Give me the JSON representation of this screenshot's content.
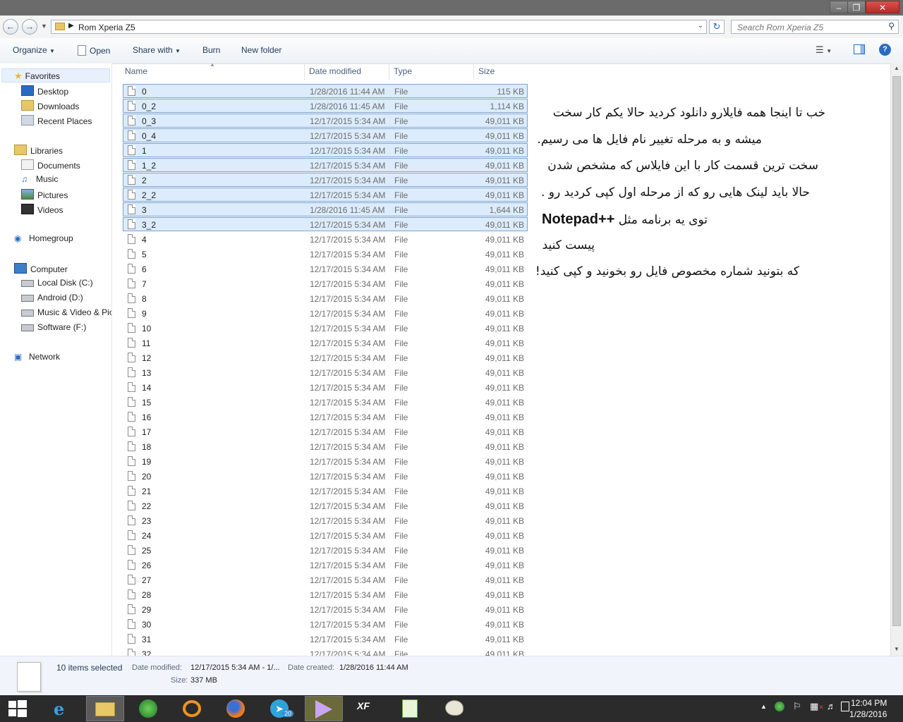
{
  "address": {
    "path": "Rom Xperia Z5",
    "search_placeholder": "Search Rom Xperia Z5"
  },
  "toolbar": {
    "organize": "Organize",
    "open": "Open",
    "share_with": "Share with",
    "burn": "Burn",
    "new_folder": "New folder"
  },
  "nav": {
    "favorites": "Favorites",
    "desktop": "Desktop",
    "downloads": "Downloads",
    "recent": "Recent Places",
    "libraries": "Libraries",
    "documents": "Documents",
    "music": "Music",
    "pictures": "Pictures",
    "videos": "Videos",
    "homegroup": "Homegroup",
    "computer": "Computer",
    "local_disk": "Local Disk (C:)",
    "android": "Android (D:)",
    "music_video": "Music & Video & Pic",
    "software": "Software (F:)",
    "network": "Network"
  },
  "columns": {
    "name": "Name",
    "date": "Date modified",
    "type": "Type",
    "size": "Size"
  },
  "files": [
    {
      "name": "0",
      "date": "1/28/2016 11:44 AM",
      "type": "File",
      "size": "115 KB",
      "selected": true
    },
    {
      "name": "0_2",
      "date": "1/28/2016 11:45 AM",
      "type": "File",
      "size": "1,114 KB",
      "selected": true
    },
    {
      "name": "0_3",
      "date": "12/17/2015 5:34 AM",
      "type": "File",
      "size": "49,011 KB",
      "selected": true
    },
    {
      "name": "0_4",
      "date": "12/17/2015 5:34 AM",
      "type": "File",
      "size": "49,011 KB",
      "selected": true
    },
    {
      "name": "1",
      "date": "12/17/2015 5:34 AM",
      "type": "File",
      "size": "49,011 KB",
      "selected": true
    },
    {
      "name": "1_2",
      "date": "12/17/2015 5:34 AM",
      "type": "File",
      "size": "49,011 KB",
      "selected": true
    },
    {
      "name": "2",
      "date": "12/17/2015 5:34 AM",
      "type": "File",
      "size": "49,011 KB",
      "selected": true
    },
    {
      "name": "2_2",
      "date": "12/17/2015 5:34 AM",
      "type": "File",
      "size": "49,011 KB",
      "selected": true
    },
    {
      "name": "3",
      "date": "1/28/2016 11:45 AM",
      "type": "File",
      "size": "1,644 KB",
      "selected": true
    },
    {
      "name": "3_2",
      "date": "12/17/2015 5:34 AM",
      "type": "File",
      "size": "49,011 KB",
      "selected": true
    },
    {
      "name": "4",
      "date": "12/17/2015 5:34 AM",
      "type": "File",
      "size": "49,011 KB"
    },
    {
      "name": "5",
      "date": "12/17/2015 5:34 AM",
      "type": "File",
      "size": "49,011 KB"
    },
    {
      "name": "6",
      "date": "12/17/2015 5:34 AM",
      "type": "File",
      "size": "49,011 KB"
    },
    {
      "name": "7",
      "date": "12/17/2015 5:34 AM",
      "type": "File",
      "size": "49,011 KB"
    },
    {
      "name": "8",
      "date": "12/17/2015 5:34 AM",
      "type": "File",
      "size": "49,011 KB"
    },
    {
      "name": "9",
      "date": "12/17/2015 5:34 AM",
      "type": "File",
      "size": "49,011 KB"
    },
    {
      "name": "10",
      "date": "12/17/2015 5:34 AM",
      "type": "File",
      "size": "49,011 KB"
    },
    {
      "name": "11",
      "date": "12/17/2015 5:34 AM",
      "type": "File",
      "size": "49,011 KB"
    },
    {
      "name": "12",
      "date": "12/17/2015 5:34 AM",
      "type": "File",
      "size": "49,011 KB"
    },
    {
      "name": "13",
      "date": "12/17/2015 5:34 AM",
      "type": "File",
      "size": "49,011 KB"
    },
    {
      "name": "14",
      "date": "12/17/2015 5:34 AM",
      "type": "File",
      "size": "49,011 KB"
    },
    {
      "name": "15",
      "date": "12/17/2015 5:34 AM",
      "type": "File",
      "size": "49,011 KB"
    },
    {
      "name": "16",
      "date": "12/17/2015 5:34 AM",
      "type": "File",
      "size": "49,011 KB"
    },
    {
      "name": "17",
      "date": "12/17/2015 5:34 AM",
      "type": "File",
      "size": "49,011 KB"
    },
    {
      "name": "18",
      "date": "12/17/2015 5:34 AM",
      "type": "File",
      "size": "49,011 KB"
    },
    {
      "name": "19",
      "date": "12/17/2015 5:34 AM",
      "type": "File",
      "size": "49,011 KB"
    },
    {
      "name": "20",
      "date": "12/17/2015 5:34 AM",
      "type": "File",
      "size": "49,011 KB"
    },
    {
      "name": "21",
      "date": "12/17/2015 5:34 AM",
      "type": "File",
      "size": "49,011 KB"
    },
    {
      "name": "22",
      "date": "12/17/2015 5:34 AM",
      "type": "File",
      "size": "49,011 KB"
    },
    {
      "name": "23",
      "date": "12/17/2015 5:34 AM",
      "type": "File",
      "size": "49,011 KB"
    },
    {
      "name": "24",
      "date": "12/17/2015 5:34 AM",
      "type": "File",
      "size": "49,011 KB"
    },
    {
      "name": "25",
      "date": "12/17/2015 5:34 AM",
      "type": "File",
      "size": "49,011 KB"
    },
    {
      "name": "26",
      "date": "12/17/2015 5:34 AM",
      "type": "File",
      "size": "49,011 KB"
    },
    {
      "name": "27",
      "date": "12/17/2015 5:34 AM",
      "type": "File",
      "size": "49,011 KB"
    },
    {
      "name": "28",
      "date": "12/17/2015 5:34 AM",
      "type": "File",
      "size": "49,011 KB"
    },
    {
      "name": "29",
      "date": "12/17/2015 5:34 AM",
      "type": "File",
      "size": "49,011 KB"
    },
    {
      "name": "30",
      "date": "12/17/2015 5:34 AM",
      "type": "File",
      "size": "49,011 KB"
    },
    {
      "name": "31",
      "date": "12/17/2015 5:34 AM",
      "type": "File",
      "size": "49,011 KB"
    },
    {
      "name": "32",
      "date": "12/17/2015 5:34 AM",
      "type": "File",
      "size": "49,011 KB"
    }
  ],
  "annotation": {
    "line1": "خب تا اینجا همه فایلارو دانلود کردید حالا یکم کار سخت",
    "line2": "میشه و به مرحله تغییر نام فایل ها می رسیم.",
    "line3": "سخت ترین قسمت کار با این فایلاس که مشخص شدن",
    "line4": "حالا باید لینک هایی رو که از مرحله اول کپی کردید رو .",
    "line5_rtl": "توی یه برنامه مثل",
    "line5_brand": "Notepad++",
    "line6": "پیست کنید",
    "line7": "که بتونید شماره مخصوص فایل رو بخونید و کپی کنید!"
  },
  "details": {
    "selected": "10 items selected",
    "date_modified_label": "Date modified:",
    "date_modified_value": "12/17/2015 5:34 AM - 1/...",
    "date_created_label": "Date created:",
    "date_created_value": "1/28/2016 11:44 AM",
    "size_label": "Size:",
    "size_value": "337 MB"
  },
  "tray": {
    "time": "12:04 PM",
    "date": "1/28/2016",
    "telegram_badge": "20"
  },
  "colors": {
    "selection": "#dcecfc",
    "selection_border": "#7da2ce",
    "taskbar": "#2b2b2b"
  }
}
